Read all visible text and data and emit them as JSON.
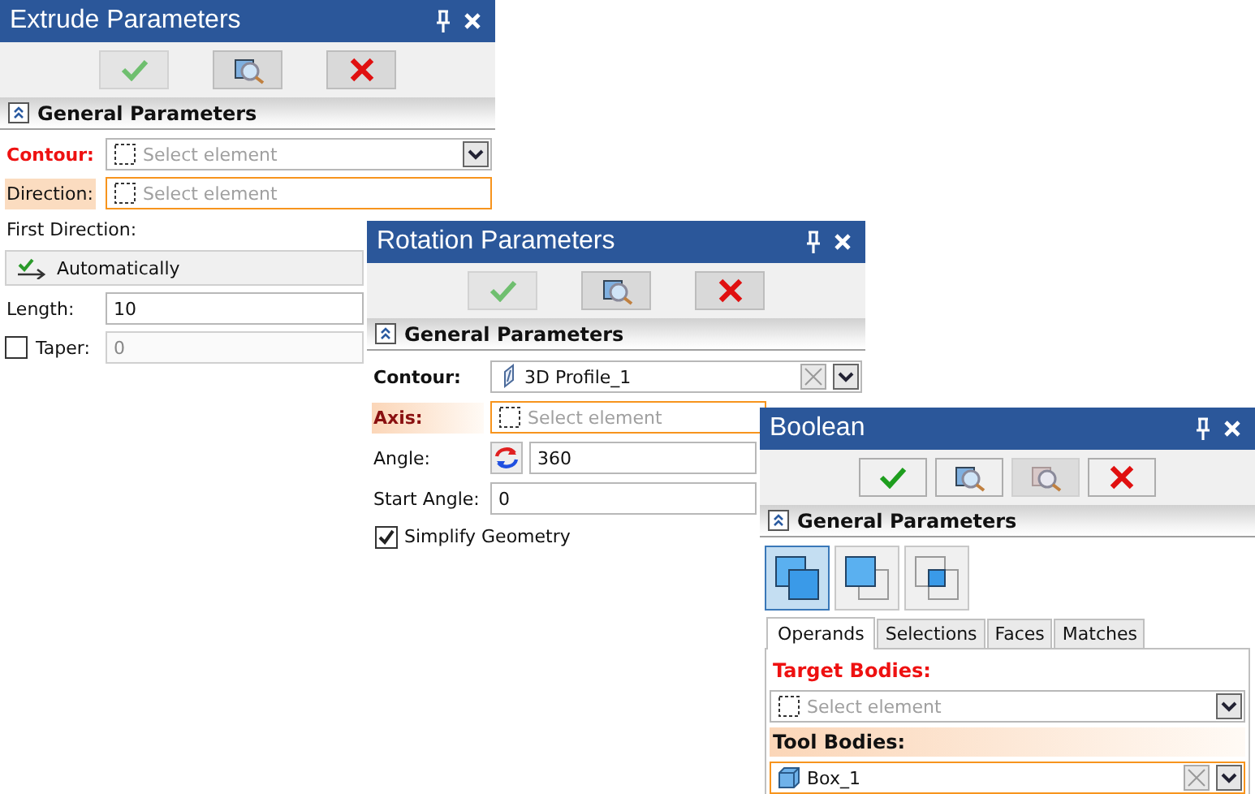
{
  "panels": [
    {
      "title": "Extrude Parameters",
      "active": false,
      "toolbar": [
        {
          "kind": "ok",
          "disabled": true
        },
        {
          "kind": "preview",
          "disabled": false
        },
        {
          "kind": "cancel",
          "disabled": false
        }
      ],
      "section": {
        "title": "General Parameters",
        "expanded": true
      },
      "rows": [
        {
          "kind": "select",
          "label": "Contour:",
          "required": true,
          "pending": false,
          "bold": true,
          "placeholder": "Select element",
          "dropdown": true,
          "focused": false
        },
        {
          "kind": "select",
          "label": "Direction:",
          "required": false,
          "pending": true,
          "bold": false,
          "placeholder": "Select element",
          "dropdown": false,
          "focused": true
        },
        {
          "kind": "caption",
          "text": "First Direction:"
        },
        {
          "kind": "option",
          "text": "Automatically"
        },
        {
          "kind": "number",
          "label": "Length:",
          "value": "10"
        },
        {
          "kind": "number",
          "label": "Taper:",
          "value": "0",
          "checkbox": true,
          "checked": false,
          "disabled": true
        }
      ]
    },
    {
      "title": "Rotation Parameters",
      "active": false,
      "toolbar": [
        {
          "kind": "ok",
          "disabled": true
        },
        {
          "kind": "preview",
          "disabled": false
        },
        {
          "kind": "cancel",
          "disabled": false
        }
      ],
      "section": {
        "title": "General Parameters",
        "expanded": true
      },
      "rows": [
        {
          "kind": "profile",
          "label": "Contour:",
          "required": false,
          "pending": false,
          "bold": true,
          "value": "3D Profile_1",
          "clear": true,
          "dropdown": true,
          "focused": false
        },
        {
          "kind": "select",
          "label": "Axis:",
          "required": true,
          "pending": true,
          "bold": true,
          "placeholder": "Select element",
          "dropdown": false,
          "focused": true
        },
        {
          "kind": "number",
          "label": "Angle:",
          "value": "360",
          "flip": true
        },
        {
          "kind": "number",
          "label": "Start Angle:",
          "value": "0"
        },
        {
          "kind": "check",
          "text": "Simplify Geometry",
          "checked": true
        }
      ]
    },
    {
      "title": "Boolean",
      "active": true,
      "toolbar": [
        {
          "kind": "ok",
          "disabled": false
        },
        {
          "kind": "preview",
          "disabled": false
        },
        {
          "kind": "preview",
          "disabled": true
        },
        {
          "kind": "cancel",
          "disabled": false
        }
      ],
      "section": {
        "title": "General Parameters",
        "expanded": true
      },
      "modes": [
        {
          "kind": "union",
          "selected": true
        },
        {
          "kind": "subtract",
          "selected": false
        },
        {
          "kind": "intersect",
          "selected": false
        }
      ],
      "tabs": [
        {
          "label": "Operands",
          "selected": true
        },
        {
          "label": "Selections",
          "selected": false
        },
        {
          "label": "Faces",
          "selected": false
        },
        {
          "label": "Matches",
          "selected": false
        }
      ],
      "rows": [
        {
          "kind": "caption",
          "text": "Target Bodies:",
          "required": true,
          "pending": false,
          "bold": true
        },
        {
          "kind": "select",
          "placeholder": "Select element",
          "dropdown": true,
          "focused": false
        },
        {
          "kind": "caption",
          "text": "Tool Bodies:",
          "required": false,
          "pending": true,
          "bold": true
        },
        {
          "kind": "body",
          "value": "Box_1",
          "clear": true,
          "dropdown": true,
          "focused": true
        }
      ]
    }
  ]
}
